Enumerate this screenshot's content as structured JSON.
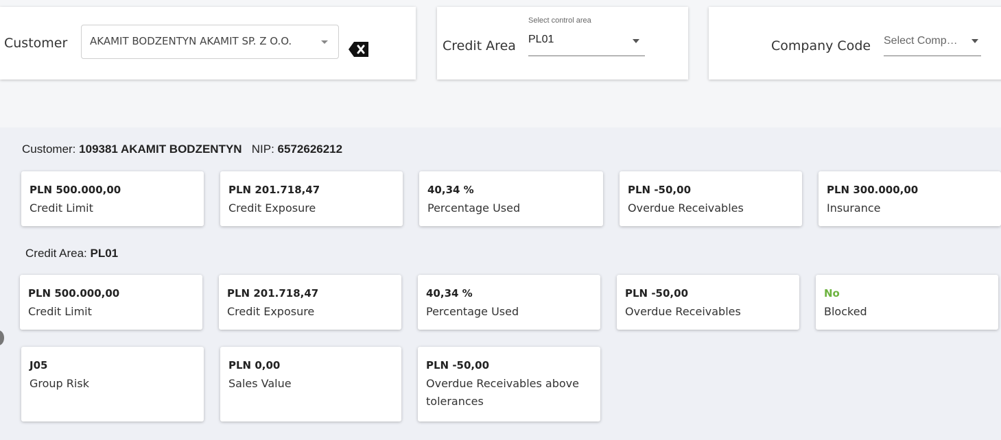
{
  "filters": {
    "customer": {
      "label": "Customer",
      "value": "AKAMIT BODZENTYN AKAMIT SP. Z O.O.",
      "clear_icon": "backspace-x-icon"
    },
    "credit_area": {
      "label": "Credit Area",
      "floating_label": "Select control area",
      "value": "PL01"
    },
    "company_code": {
      "label": "Company Code",
      "placeholder": "Select Comp…"
    }
  },
  "customer_info": {
    "label": "Customer:",
    "name": "109381 AKAMIT BODZENTYN",
    "nip_label": "NIP:",
    "nip": "6572626212",
    "cards": [
      {
        "value": "PLN 500.000,00",
        "label": "Credit Limit"
      },
      {
        "value": "PLN 201.718,47",
        "label": "Credit Exposure"
      },
      {
        "value": "40,34 %",
        "label": "Percentage Used"
      },
      {
        "value": "PLN -50,00",
        "label": "Overdue Receivables"
      },
      {
        "value": "PLN 300.000,00",
        "label": "Insurance"
      }
    ]
  },
  "credit_area_info": {
    "label": "Credit Area:",
    "value": "PL01",
    "cards": [
      {
        "value": "PLN 500.000,00",
        "label": "Credit Limit"
      },
      {
        "value": "PLN 201.718,47",
        "label": "Credit Exposure"
      },
      {
        "value": "40,34 %",
        "label": "Percentage Used"
      },
      {
        "value": "PLN -50,00",
        "label": "Overdue Receivables"
      },
      {
        "value": "No",
        "label": "Blocked"
      },
      {
        "value": "J05",
        "label": "Group Risk"
      },
      {
        "value": "PLN 0,00",
        "label": "Sales Value"
      },
      {
        "value": "PLN -50,00",
        "label": "Overdue Receivables above tolerances"
      }
    ]
  },
  "colors": {
    "accent_green": "#6db33f",
    "background": "#eef0f5"
  }
}
